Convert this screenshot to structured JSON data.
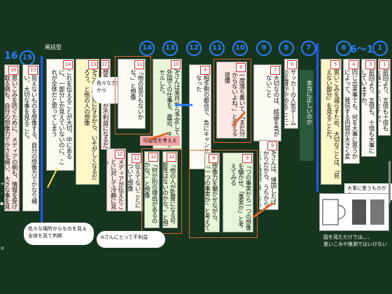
{
  "title": "尾括型",
  "left_marks": {
    "n16": "16",
    "n15": "15"
  },
  "circle_marks": [
    "14",
    "13",
    "12",
    "11",
    "10",
    "9",
    "8",
    "7",
    "6",
    "1"
  ],
  "range_label": "6〜1",
  "hints": {
    "vertical_note": "本当に正しいのか",
    "possibility": "可能性を考える",
    "many_angles": "色々な方向から",
    "big_thing": "大事に思うものが違う",
    "lower_right": "図を見ただけでは、、、",
    "lower_right_2": "思いこみや推測ではいけない",
    "bottom_left_1": "色々な場所からものを見る",
    "bottom_left_2": "全体を見て判断",
    "bottom_mid": "Aさんにとって不利益"
  },
  "cards": {
    "c16": {
      "num": "16",
      "text": "思いこみを防ぐために、メディアの側も、情報を受け取る側も、自分の想像力でかさを補い、大きな事を見る事が大切。"
    },
    "c15": {
      "num": "15",
      "text": "見えないものを想像する。自分の想像力でかなり補い、大切な事を見ること。"
    },
    "c14": {
      "num": "14",
      "text": "これを伝えることが大切、中にあるに、一部分しか見えていないのに、これが全体だと思ってしまう"
    },
    "c13": {
      "num": "13",
      "text": "Aさんは監督になるから、いそがしくなるだろう。と他の人の想像"
    },
    "c12": {
      "num": "12",
      "text": "想像したことが不利益になるだろうと思った"
    },
    "c11": {
      "num": "11",
      "text": "「他の見方もないかな。」と想像"
    },
    "c10": {
      "num": "10",
      "text": "Aさんは来月から予定していた外国での仕事を、最近、キャンセルした。"
    },
    "c9": {
      "num": "9",
      "text": "相手側の都合で、急にキャンセルになった"
    },
    "c8": {
      "num": "8",
      "text": "一度落ち着いて、「まだ分からないよね。」と考える習慣"
    },
    "c7": {
      "num": "7",
      "text": "大切なのは、結論を急がないこと"
    },
    "c6": {
      "num": "6",
      "text": "サッカーの人気チームの監督がやめることになり、新しい監督になるが、次の監督の予想が注目を集めている。"
    },
    "c5": {
      "num": "5",
      "text": "思いこみを減らすため、大切なことは、「見えない部分」を見ることだ。"
    },
    "c4": {
      "num": "4",
      "text": "同じ出来事でも、何を大事に思うかによって、発信する内容が大きく変わる"
    },
    "c3": {
      "num": "3",
      "text": "前回より、五倍も、十倍も大事にしていますか。"
    },
    "c1": {
      "num": "1",
      "text": "前回より、五倍も十倍も大事にしていますか。"
    },
    "m1": {
      "num": "12",
      "text": "「他の人が監督になる可能性はないのかな。」と想像"
    },
    "m2": {
      "num": "12",
      "text": "「何か別の理由があるのかな。」と想像"
    },
    "m3": {
      "num": "12",
      "text": "伝えてないことについて想像"
    },
    "m4": {
      "num": "12",
      "text": "メディアが伝えたことに対して冷静に見る"
    },
    "m5": {
      "num": "9",
      "text": "Aさんは、帰国したばかりだから、うちからにいる時間が長くなる"
    },
    "m6": {
      "num": "9",
      "text": "「つの事実から一つの想像を働かせ、「事実か」と考えてみる"
    },
    "m7": {
      "num": "9",
      "text": "想像力を働かせながら、「一つの事実か」と考えてみることが大切"
    }
  }
}
